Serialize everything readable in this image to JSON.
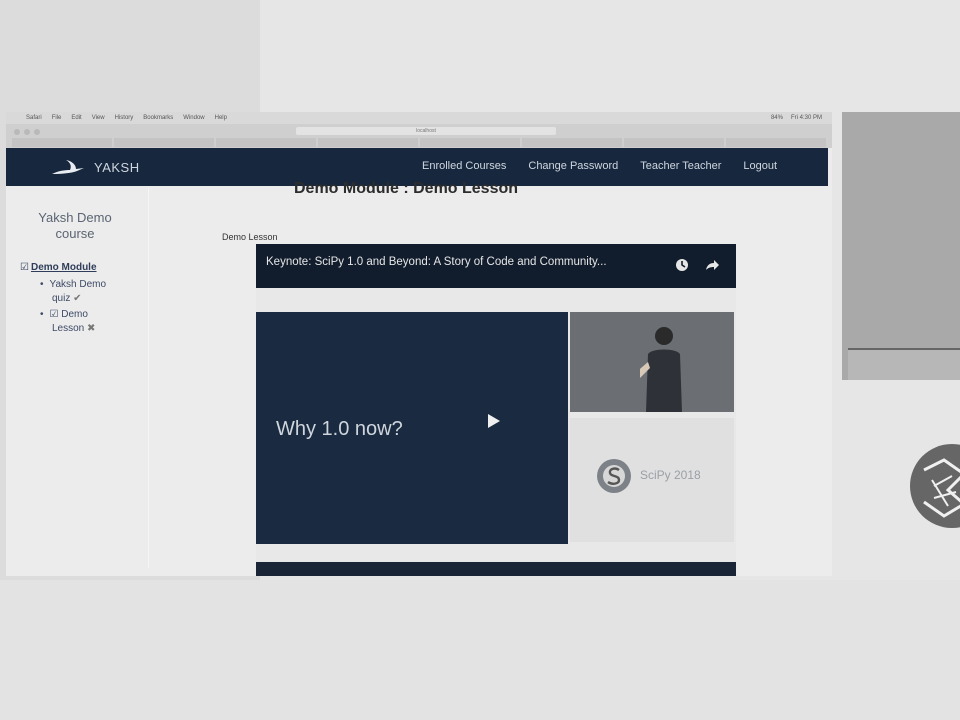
{
  "menubar": {
    "items": [
      "Safari",
      "File",
      "Edit",
      "View",
      "History",
      "Bookmarks",
      "Window",
      "Help"
    ],
    "battery": "84%",
    "clock": "Fri 4:30 PM"
  },
  "browser": {
    "address": "localhost"
  },
  "nav": {
    "brand": "YAKSH",
    "links": [
      "Enrolled Courses",
      "Change Password",
      "Teacher Teacher",
      "Logout"
    ]
  },
  "page": {
    "title": "Demo Module : Demo Lesson",
    "lesson_label": "Demo Lesson"
  },
  "sidebar": {
    "course_title": "Yaksh Demo course",
    "module": "Demo Module",
    "items": [
      {
        "line1": "Yaksh Demo",
        "line2": "quiz",
        "mark": "✔"
      },
      {
        "line1": "Demo",
        "line2": "Lesson",
        "mark": "✖"
      }
    ]
  },
  "video": {
    "title": "Keynote: SciPy 1.0 and Beyond: A Story of Code and Community...",
    "slide_text": "Why 1.0 now?",
    "sponsor": "SciPy 2018"
  }
}
